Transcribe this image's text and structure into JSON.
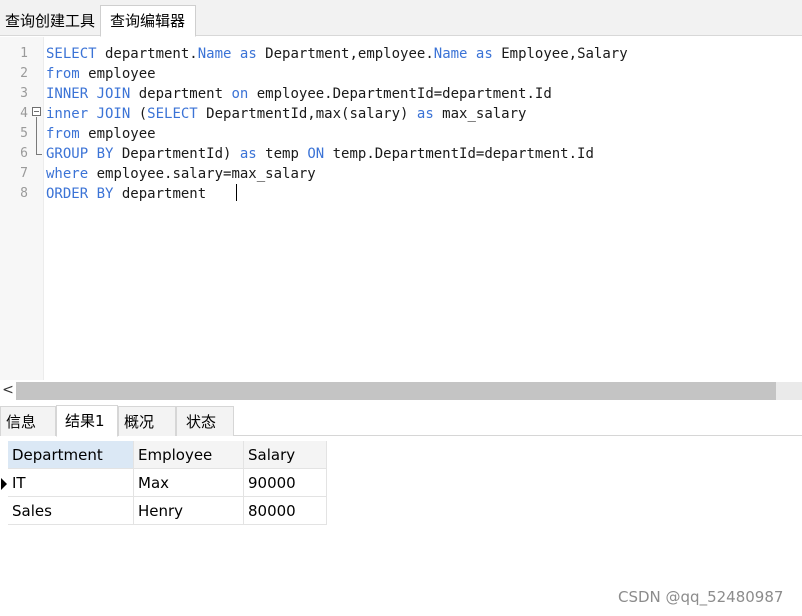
{
  "top_tabs": {
    "query_builder": "查询创建工具",
    "query_editor": "查询编辑器"
  },
  "editor": {
    "line_numbers": [
      "1",
      "2",
      "3",
      "4",
      "5",
      "6",
      "7",
      "8"
    ],
    "lines": [
      {
        "tokens": [
          {
            "t": "SELECT",
            "k": true
          },
          {
            "t": " department."
          },
          {
            "t": "Name",
            "k": true
          },
          {
            "t": " "
          },
          {
            "t": "as",
            "k": true
          },
          {
            "t": " Department,employee."
          },
          {
            "t": "Name",
            "k": true
          },
          {
            "t": " "
          },
          {
            "t": "as",
            "k": true
          },
          {
            "t": " Employee,Salary"
          }
        ]
      },
      {
        "tokens": [
          {
            "t": "from",
            "k": true
          },
          {
            "t": " employee"
          }
        ]
      },
      {
        "tokens": [
          {
            "t": "INNER JOIN",
            "k": true
          },
          {
            "t": " department "
          },
          {
            "t": "on",
            "k": true
          },
          {
            "t": " employee.DepartmentId=department.Id"
          }
        ]
      },
      {
        "tokens": [
          {
            "t": "inner JOIN",
            "k": true
          },
          {
            "t": " ("
          },
          {
            "t": "SELECT",
            "k": true
          },
          {
            "t": " DepartmentId,max(salary) "
          },
          {
            "t": "as",
            "k": true
          },
          {
            "t": " max_salary"
          }
        ]
      },
      {
        "tokens": [
          {
            "t": "from",
            "k": true
          },
          {
            "t": " employee"
          }
        ]
      },
      {
        "tokens": [
          {
            "t": "GROUP BY",
            "k": true
          },
          {
            "t": " DepartmentId) "
          },
          {
            "t": "as",
            "k": true
          },
          {
            "t": " temp "
          },
          {
            "t": "ON",
            "k": true
          },
          {
            "t": " temp.DepartmentId=department.Id"
          }
        ]
      },
      {
        "tokens": [
          {
            "t": "where",
            "k": true
          },
          {
            "t": " employee.salary=max_salary"
          }
        ]
      },
      {
        "tokens": [
          {
            "t": "ORDER BY",
            "k": true
          },
          {
            "t": " department"
          }
        ]
      }
    ]
  },
  "scrollbar": {
    "left_arrow": "<"
  },
  "result_tabs": {
    "info": "信息",
    "result1": "结果1",
    "overview": "概况",
    "status": "状态"
  },
  "grid": {
    "columns": [
      "Department",
      "Employee",
      "Salary"
    ],
    "rows": [
      [
        "IT",
        "Max",
        "90000"
      ],
      [
        "Sales",
        "Henry",
        "80000"
      ]
    ]
  },
  "watermark": "CSDN @qq_52480987",
  "colors": {
    "keyword": "#3b73d6",
    "selected_header": "#dbe8f5"
  }
}
